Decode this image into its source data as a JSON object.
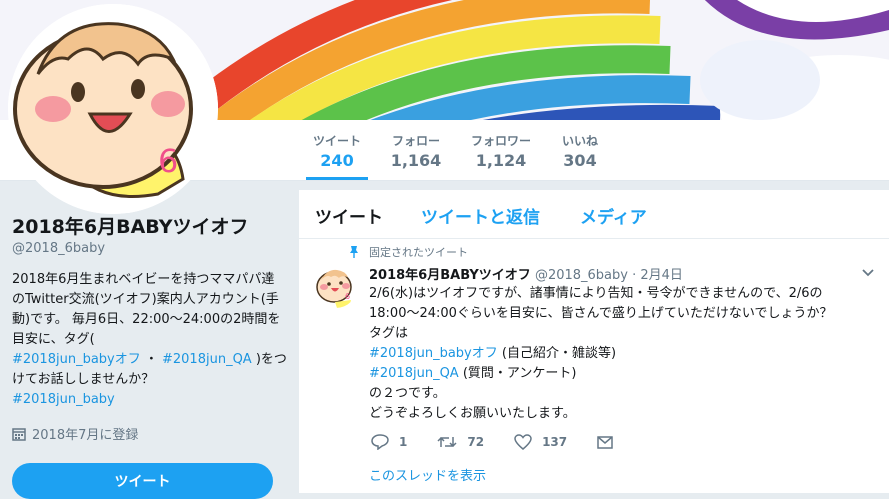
{
  "colors": {
    "accent": "#1da1f2",
    "link": "#1b95e0",
    "muted": "#657786"
  },
  "stats": [
    {
      "label": "ツイート",
      "value": "240"
    },
    {
      "label": "フォロー",
      "value": "1,164"
    },
    {
      "label": "フォロワー",
      "value": "1,124"
    },
    {
      "label": "いいね",
      "value": "304"
    }
  ],
  "avatar": {
    "badge": "6"
  },
  "profile": {
    "name": "2018年6月BABYツイオフ",
    "handle": "@2018_6baby",
    "bio_text": "2018年6月生まれベイビーを持つママパパ達のTwitter交流(ツイオフ)案内人アカウント(手動)です。 毎月6日、22:00〜24:00の2時間を目安に、タグ(",
    "bio_tag1": "#2018jun_babyオフ",
    "bio_sep": " ・ ",
    "bio_tag2": "#2018jun_QA",
    "bio_text2": " )をつけてお話ししませんか？",
    "bio_tag3": "#2018jun_baby",
    "joined": "2018年7月に登録",
    "tweet_button": "ツイート"
  },
  "tabs": [
    "ツイート",
    "ツイートと返信",
    "メディア"
  ],
  "tweet": {
    "pinned_label": "固定されたツイート",
    "name": "2018年6月BABYツイオフ",
    "handle": "@2018_6baby",
    "date": "· 2月4日",
    "avatar_badge": "6",
    "line1": "2/6(水)はツイオフですが、諸事情により告知・号令ができませんので、2/6の18:00〜24:00ぐらいを目安に、皆さんで盛り上げていただけないでしょうか？",
    "line2": "タグは",
    "tag1": "#2018jun_babyオフ",
    "tag1_note": " (自己紹介・雑談等)",
    "tag2": "#2018jun_QA",
    "tag2_note": " (質問・アンケート)",
    "line3": "の２つです。",
    "line4": "どうぞよろしくお願いいたします。",
    "replies": "1",
    "retweets": "72",
    "likes": "137",
    "thread_link": "このスレッドを表示"
  }
}
